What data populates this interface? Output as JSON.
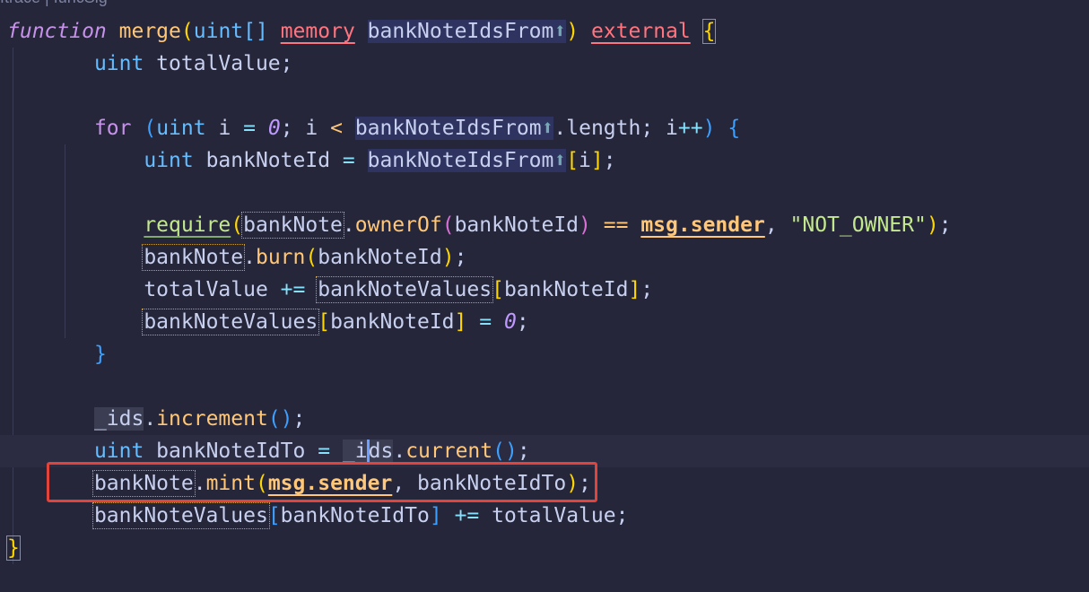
{
  "breadcrumb": "ftrace | funcSig",
  "code": {
    "l1": {
      "kw": "function",
      "name": "merge",
      "open": "(",
      "type": "uint[]",
      "space1": " ",
      "loc": "memory",
      "space2": " ",
      "param": "bankNoteIdsFrom",
      "param_icon": "⬆",
      "close": ")",
      "space3": " ",
      "vis": "external",
      "space4": " ",
      "brace": "{"
    },
    "l2": {
      "type": "uint",
      "rest": " totalValue;"
    },
    "l4": {
      "kw": "for",
      "open": "(",
      "type": "uint",
      "i1": " i ",
      "eq": "=",
      "zero": "0",
      "semi1": "; i ",
      "lt": "<",
      "sp": " ",
      "param": "bankNoteIdsFrom",
      "param_icon": "⬆",
      "len": ".length; i",
      "inc": "++",
      "close": ")",
      "sp2": " ",
      "brace": "{"
    },
    "l5": {
      "type": "uint",
      "var": " bankNoteId ",
      "eq": "=",
      "sp": " ",
      "param": "bankNoteIdsFrom",
      "param_icon": "⬆",
      "open": "[",
      "idx": "i",
      "close": "]",
      "semi": ";"
    },
    "l7": {
      "req": "require",
      "open": "(",
      "obj": "bankNote",
      "dot": ".",
      "fn": "ownerOf",
      "open2": "(",
      "arg": "bankNoteId",
      "close2": ")",
      "sp": " ",
      "eqeq": "==",
      "sp2": " ",
      "msg": "msg.sender",
      "comma": ", ",
      "str": "\"NOT_OWNER\"",
      "close": ")",
      "semi": ";"
    },
    "l8": {
      "obj": "bankNote",
      "dot": ".",
      "fn": "burn",
      "open": "(",
      "arg": "bankNoteId",
      "close": ")",
      "semi": ";"
    },
    "l9": {
      "var": "totalValue ",
      "op": "+=",
      "sp": " ",
      "obj": "bankNoteValues",
      "open": "[",
      "idx": "bankNoteId",
      "close": "]",
      "semi": ";"
    },
    "l10": {
      "obj": "bankNoteValues",
      "open": "[",
      "idx": "bankNoteId",
      "close": "]",
      "sp": " ",
      "eq": "=",
      "sp2": " ",
      "zero": "0",
      "semi": ";"
    },
    "l11": {
      "brace": "}"
    },
    "l13": {
      "obj": "_ids",
      "dot": ".",
      "fn": "increment",
      "open": "(",
      "close": ")",
      "semi": ";"
    },
    "l14": {
      "type": "uint",
      "var": " bankNoteIdTo ",
      "eq": "=",
      "sp": " ",
      "obj_a": "_i",
      "obj_b": "ds",
      "dot": ".",
      "fn": "current",
      "open": "(",
      "close": ")",
      "semi": ";"
    },
    "l15": {
      "obj": "bankNote",
      "dot": ".",
      "fn": "mint",
      "open": "(",
      "msg": "msg.sender",
      "comma": ", bankNoteIdTo",
      "close": ")",
      "semi": ";"
    },
    "l16": {
      "obj": "bankNoteValues",
      "open": "[",
      "idx": "bankNoteIdTo",
      "close": "]",
      "sp": " ",
      "op": "+=",
      "rest": " totalValue;"
    },
    "l17": {
      "brace": "}"
    }
  },
  "colors": {
    "background": "#25263a",
    "highlight_box": "#e0443b"
  }
}
